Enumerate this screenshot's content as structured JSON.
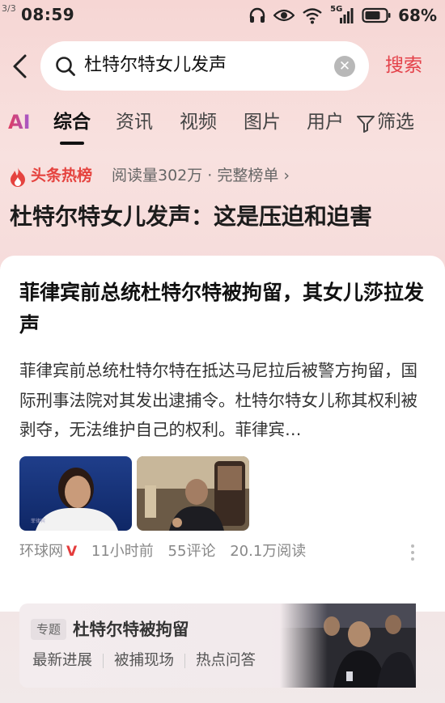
{
  "status_bar": {
    "page_indicator": "3/3",
    "time": "08:59",
    "network": "5G",
    "battery": "68%",
    "icons": [
      "headphones-icon",
      "eye-icon",
      "wifi-icon",
      "signal-icon",
      "battery-icon"
    ]
  },
  "search": {
    "query": "杜特尔特女儿发声",
    "button_label": "搜索"
  },
  "tabs": [
    {
      "label": "AI",
      "active": false
    },
    {
      "label": "综合",
      "active": true
    },
    {
      "label": "资讯",
      "active": false
    },
    {
      "label": "视频",
      "active": false
    },
    {
      "label": "图片",
      "active": false
    },
    {
      "label": "用户",
      "active": false
    },
    {
      "label": "筛选",
      "active": false
    }
  ],
  "hot_list": {
    "label": "头条热榜",
    "meta": "阅读量302万 · 完整榜单 ›",
    "headline": "杜特尔特女儿发声：这是压迫和迫害"
  },
  "article": {
    "title": "菲律宾前总统杜特尔特被拘留，其女儿莎拉发声",
    "summary": "菲律宾前总统杜特尔特在抵达马尼拉后被警方拘留，国际刑事法院对其发出逮捕令。杜特尔特女儿称其权利被剥夺，无法维护自己的权利。菲律宾…",
    "source": "环球网",
    "verified_mark": "V",
    "time": "11小时前",
    "comments": "55评论",
    "reads": "20.1万阅读"
  },
  "topic": {
    "tag": "专题",
    "title": "杜特尔特被拘留",
    "links": [
      "最新进展",
      "被捕现场",
      "热点问答"
    ]
  },
  "colors": {
    "accent_red": "#e4424a",
    "hot_orange": "#e5433f"
  }
}
